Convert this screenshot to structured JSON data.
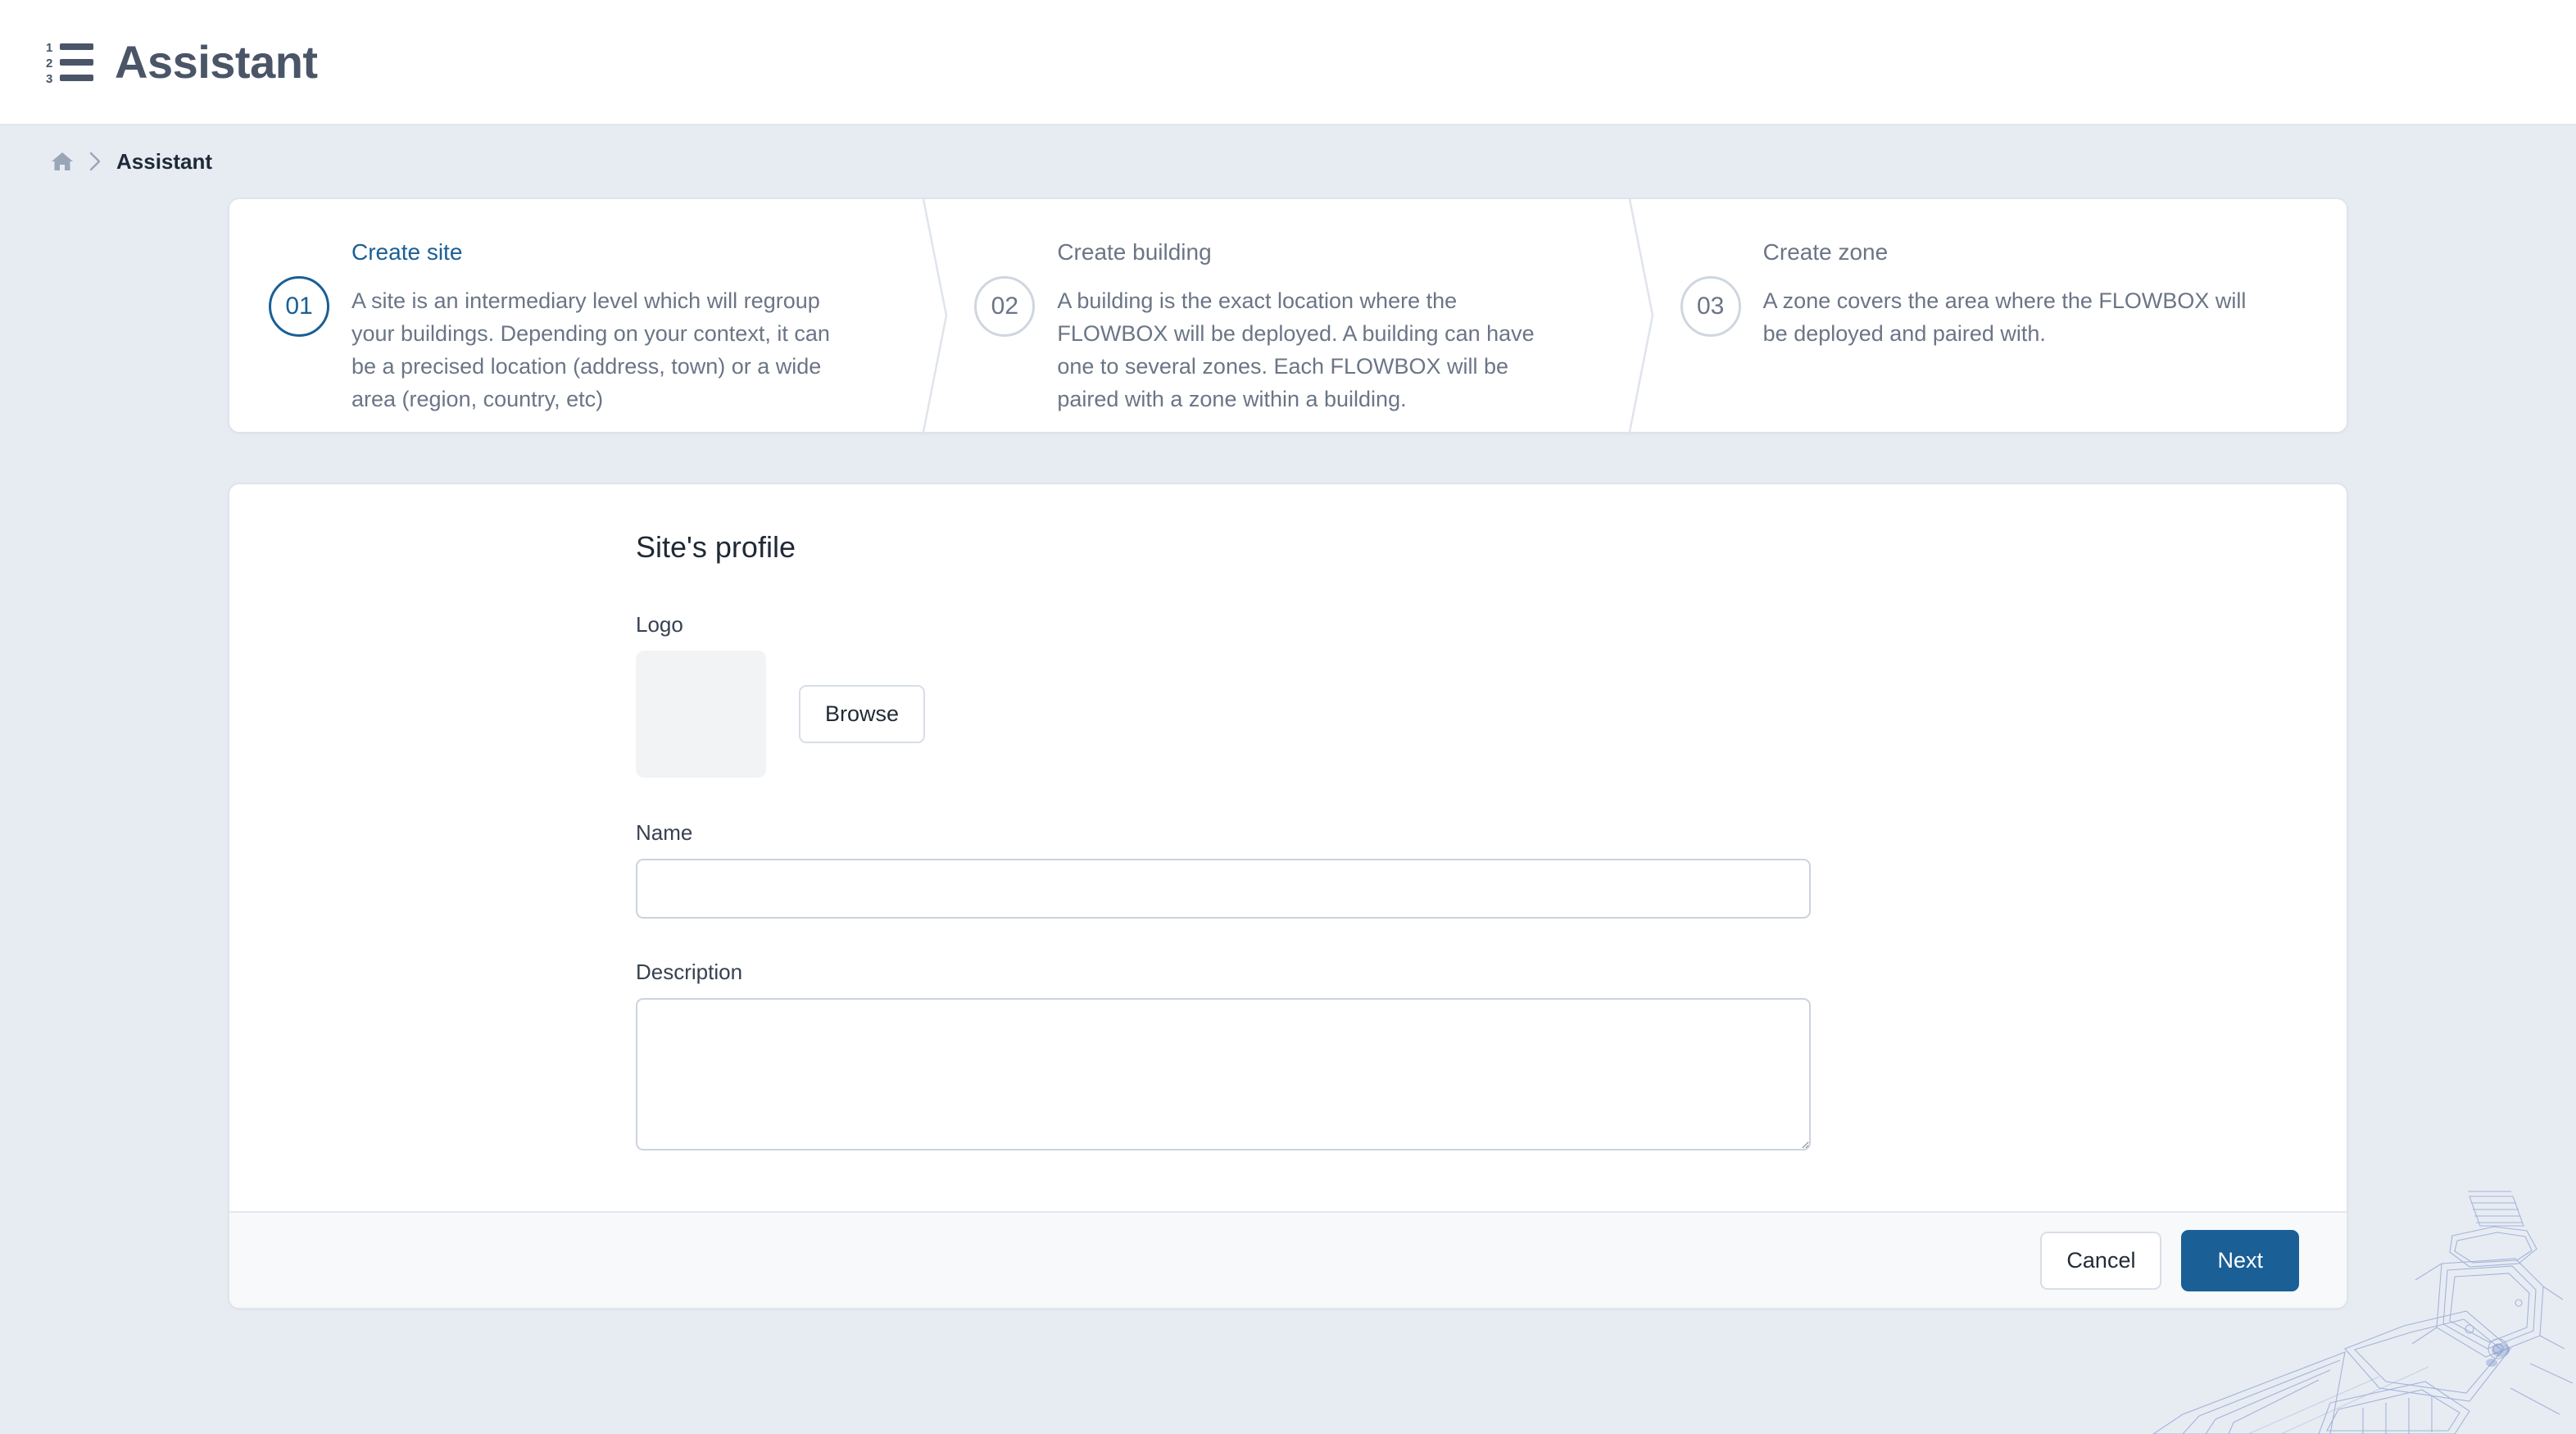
{
  "app": {
    "title": "Assistant",
    "logo_icon": "numbered-list-icon"
  },
  "breadcrumb": {
    "home_icon": "home-icon",
    "separator_icon": "chevron-right-icon",
    "current": "Assistant"
  },
  "stepper": {
    "steps": [
      {
        "number": "01",
        "title": "Create site",
        "description": "A site is an intermediary level which will regroup your buildings. Depending on your context, it can be a precised location (address, town) or a wide area (region, country, etc)",
        "active": true
      },
      {
        "number": "02",
        "title": "Create building",
        "description": "A building is the exact location where the FLOWBOX will be deployed. A building can have one to several zones. Each FLOWBOX will be paired with a zone within a building.",
        "active": false
      },
      {
        "number": "03",
        "title": "Create zone",
        "description": "A zone covers the area where the FLOWBOX will be deployed and paired with.",
        "active": false
      }
    ]
  },
  "form": {
    "title": "Site's profile",
    "logo": {
      "label": "Logo",
      "browse_label": "Browse",
      "preview_empty": true
    },
    "name": {
      "label": "Name",
      "value": "",
      "placeholder": ""
    },
    "description": {
      "label": "Description",
      "value": "",
      "placeholder": ""
    },
    "actions": {
      "cancel_label": "Cancel",
      "next_label": "Next"
    }
  },
  "colors": {
    "page_background": "#e7ecf3",
    "accent_blue": "#1a5f95",
    "card_background": "#ffffff",
    "footer_background": "#f8f9fb",
    "muted_text": "#6b7586",
    "border": "#dfe4ec"
  },
  "decoration": {
    "watermark": "technical-drawing-watermark"
  }
}
